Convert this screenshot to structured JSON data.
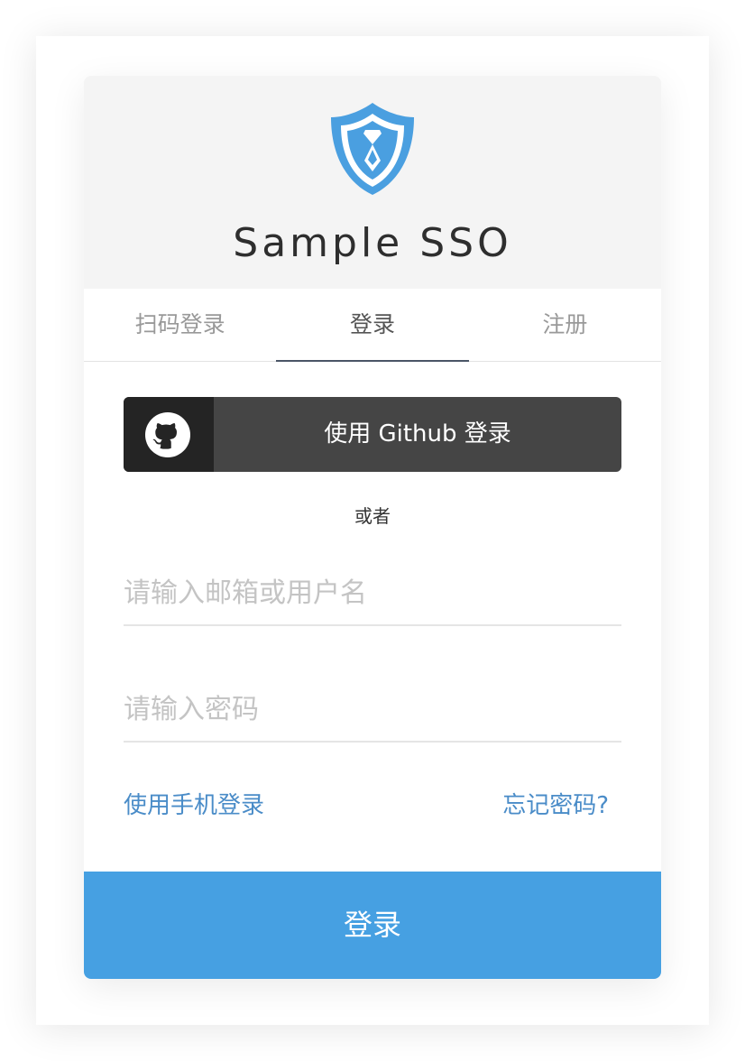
{
  "app": {
    "title": "Sample SSO",
    "brand_color": "#4a9fe0",
    "logo_icon": "shield-tie-icon"
  },
  "tabs": [
    {
      "label": "扫码登录",
      "active": false
    },
    {
      "label": "登录",
      "active": true
    },
    {
      "label": "注册",
      "active": false
    }
  ],
  "github_login": {
    "label": "使用 Github 登录",
    "icon": "github-icon"
  },
  "divider": {
    "text": "或者"
  },
  "form": {
    "username_placeholder": "请输入邮箱或用户名",
    "password_placeholder": "请输入密码",
    "phone_login_link": "使用手机登录",
    "forgot_password_link": "忘记密码?",
    "submit_label": "登录"
  }
}
